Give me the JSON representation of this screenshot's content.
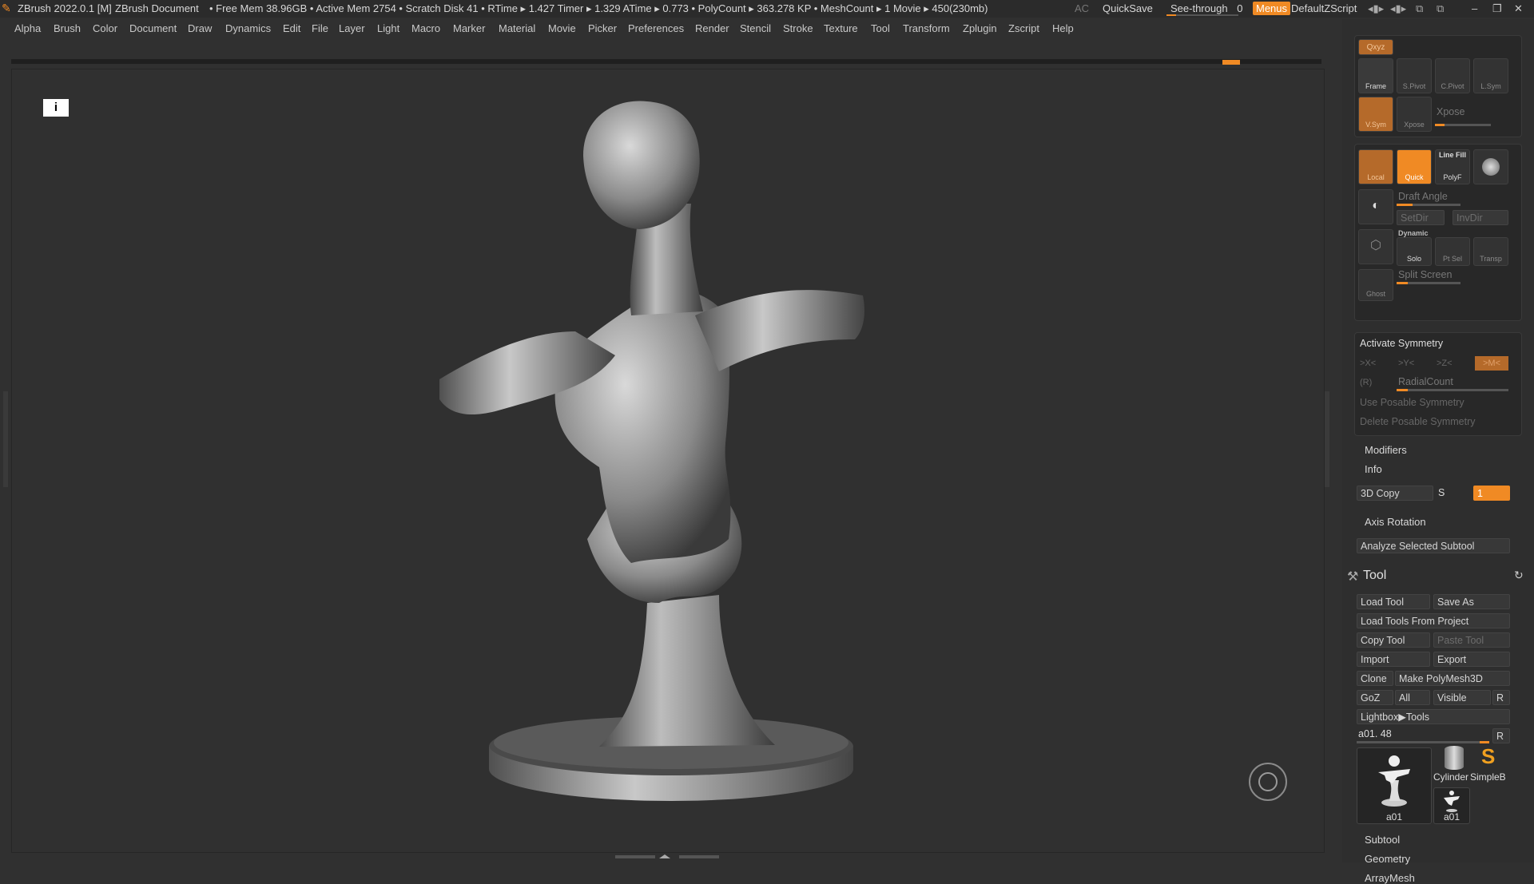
{
  "titlebar": {
    "app_title": "ZBrush 2022.0.1 [M]",
    "document": "ZBrush Document",
    "stats": "• Free Mem 38.96GB • Active Mem 2754 • Scratch Disk 41 •  RTime ▸ 1.427 Timer ▸ 1.329 ATime ▸ 0.773 • PolyCount ▸ 363.278 KP  • MeshCount ▸ 1  Movie ▸ 450(230mb)",
    "ac": "AC",
    "quicksave": "QuickSave",
    "see_through": "See-through",
    "see_through_value": "0",
    "menus": "Menus",
    "script": "DefaultZScript"
  },
  "menubar": [
    "Alpha",
    "Brush",
    "Color",
    "Document",
    "Draw",
    "Dynamics",
    "Edit",
    "File",
    "Layer",
    "Light",
    "Macro",
    "Marker",
    "Material",
    "Movie",
    "Picker",
    "Preferences",
    "Render",
    "Stencil",
    "Stroke",
    "Texture",
    "Tool",
    "Transform",
    "Zplugin",
    "Zscript",
    "Help"
  ],
  "viewport": {
    "info_icon": "i"
  },
  "panel": {
    "top_icons": [
      "Frame",
      "S.Pivot",
      "C.Pivot",
      "L.Sym",
      "Xpose"
    ],
    "xyz": "Qxyz",
    "local": "Local",
    "quick": "Quick",
    "line_fill": "Line Fill",
    "polyf": "PolyF",
    "draft_angle": "Draft Angle",
    "setdir": "SetDir",
    "invdir": "InvDir",
    "dynamic": "Dynamic",
    "solo": "Solo",
    "ptsel": "Pt Sel",
    "transp": "Transp",
    "ghost": "Ghost",
    "split_screen": "Split Screen",
    "activate_symmetry": "Activate Symmetry",
    "sym_x": ">X<",
    "sym_y": ">Y<",
    "sym_z": ">Z<",
    "sym_m": ">M<",
    "sym_r": "(R)",
    "radial_count": "RadialCount",
    "use_posable": "Use Posable Symmetry",
    "delete_posable": "Delete Posable Symmetry",
    "modifiers": "Modifiers",
    "info": "Info",
    "copy3d": "3D Copy",
    "copy3d_s": "S",
    "copy3d_val": "1",
    "axis_rotation": "Axis Rotation",
    "analyze": "Analyze Selected Subtool",
    "tool_title": "Tool",
    "load_tool": "Load Tool",
    "save_as": "Save As",
    "load_from_project": "Load Tools From Project",
    "copy_tool": "Copy Tool",
    "paste_tool": "Paste Tool",
    "import": "Import",
    "export": "Export",
    "clone": "Clone",
    "make_polymesh": "Make PolyMesh3D",
    "goz": "GoZ",
    "all": "All",
    "visible": "Visible",
    "r": "R",
    "lightbox_tools": "Lightbox▶Tools",
    "current_tool": "a01. 48",
    "thumbs": [
      "a01",
      "Cylinder",
      "SimpleB",
      "a01"
    ],
    "subtool": "Subtool",
    "geometry": "Geometry",
    "arraymesh": "ArrayMesh"
  }
}
